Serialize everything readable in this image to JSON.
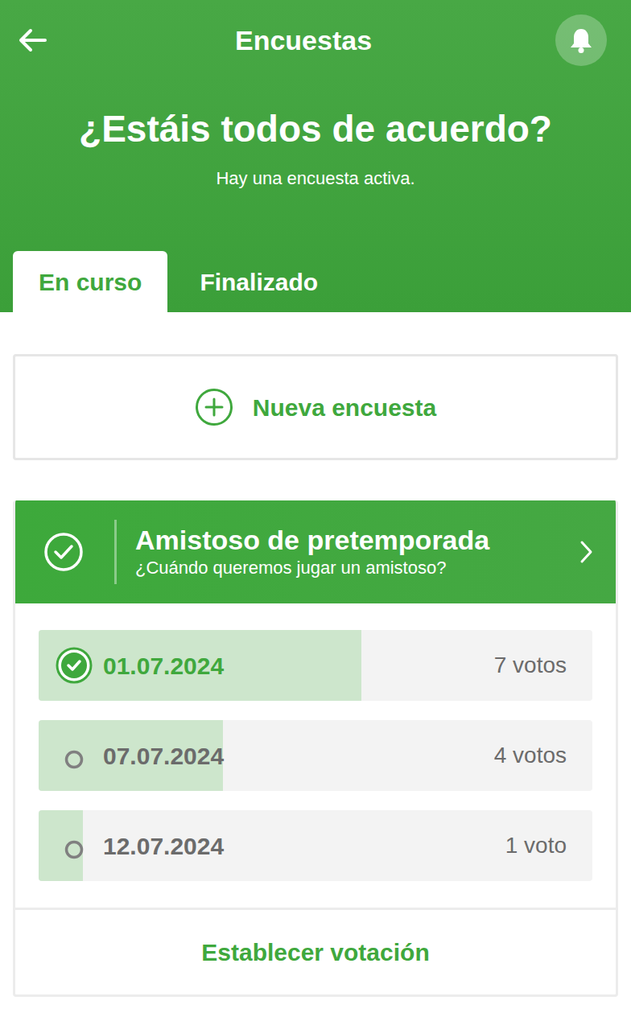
{
  "header": {
    "title": "Encuestas",
    "heading": "¿Estáis todos de acuerdo?",
    "subtitle": "Hay una encuesta activa."
  },
  "tabs": [
    {
      "label": "En curso",
      "selected": true
    },
    {
      "label": "Finalizado",
      "selected": false
    }
  ],
  "new_poll": {
    "label": "Nueva encuesta"
  },
  "poll": {
    "title": "Amistoso de pretemporada",
    "question": "¿Cuándo queremos jugar un amistoso?",
    "options": [
      {
        "label": "01.07.2024",
        "votes": "7 votos",
        "level": 0.583,
        "selected": true
      },
      {
        "label": "07.07.2024",
        "votes": "4 votos",
        "level": 0.333,
        "selected": false
      },
      {
        "label": "12.07.2024",
        "votes": "1 voto",
        "level": 0.08,
        "selected": false
      }
    ],
    "action": "Establecer votación"
  }
}
